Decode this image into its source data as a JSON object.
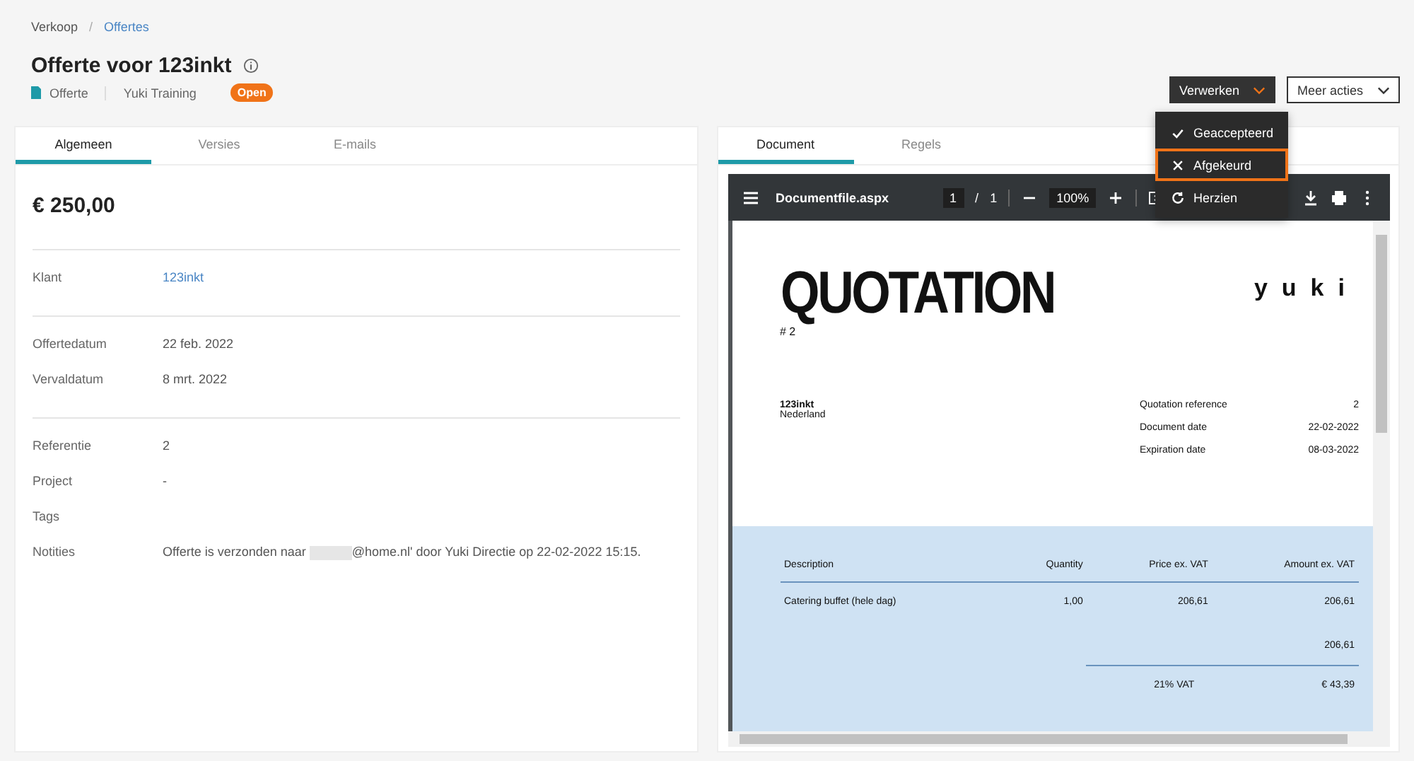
{
  "breadcrumb": [
    {
      "label": "Verkoop",
      "link": false
    },
    {
      "label": "Offertes",
      "link": true
    }
  ],
  "breadcrumb_separator": "/",
  "title": "Offerte voor 123inkt",
  "meta": {
    "doc_type": "Offerte",
    "company": "Yuki Training",
    "status": "Open"
  },
  "actions": [
    {
      "label": "Verwerken",
      "kind": "dark"
    },
    {
      "label": "Meer acties",
      "kind": "outline"
    }
  ],
  "menu": [
    {
      "label": "Geaccepteerd",
      "kind": "check",
      "selected": false
    },
    {
      "label": "Afgekeurd",
      "kind": "cross",
      "selected": true
    },
    {
      "label": "Herzien",
      "kind": "refresh",
      "selected": false
    }
  ],
  "left_tabs": [
    {
      "label": "Algemeen",
      "selected": true
    },
    {
      "label": "Versies",
      "selected": false
    },
    {
      "label": "E-mails",
      "selected": false
    }
  ],
  "amount": "€ 250,00",
  "sections": [
    [
      {
        "label": "Klant",
        "value": "123inkt",
        "kind": "link"
      }
    ],
    [
      {
        "label": "Offertedatum",
        "value": "22 feb. 2022",
        "kind": "text"
      },
      {
        "label": "Vervaldatum",
        "value": "8 mrt. 2022",
        "kind": "text"
      }
    ],
    [
      {
        "label": "Referentie",
        "value": "2",
        "kind": "text"
      },
      {
        "label": "Project",
        "value": "-",
        "kind": "text"
      },
      {
        "label": "Tags",
        "kind": "text"
      },
      {
        "label": "Notities",
        "value": "Offerte is verzonden naar ",
        "value_after": "@home.nl' door Yuki Directie op 22-02-2022 15:15.",
        "kind": "redacted"
      }
    ]
  ],
  "right_tabs": [
    {
      "label": "Document",
      "selected": true
    },
    {
      "label": "Regels",
      "selected": false
    }
  ],
  "viewer": {
    "file": "Documentfile.aspx",
    "page": "1",
    "separator": "/",
    "pages": "1",
    "zoom": "100%"
  },
  "document": {
    "title": "QUOTATION",
    "logo": "yuki",
    "number": "# 2",
    "customer": "123inkt",
    "country": "Nederland",
    "info": [
      {
        "label": "Quotation reference",
        "value": "2"
      },
      {
        "label": "Document date",
        "value": "22-02-2022"
      },
      {
        "label": "Expiration date",
        "value": "08-03-2022"
      }
    ],
    "columns": [
      "Description",
      "Quantity",
      "Price ex. VAT",
      "Amount ex. VAT"
    ],
    "rows": [
      [
        "Catering buffet (hele dag)",
        "1,00",
        "206,61",
        "206,61"
      ]
    ],
    "subtotal": "206,61",
    "vat_label": "21% VAT",
    "vat_amount": "€ 43,39"
  }
}
